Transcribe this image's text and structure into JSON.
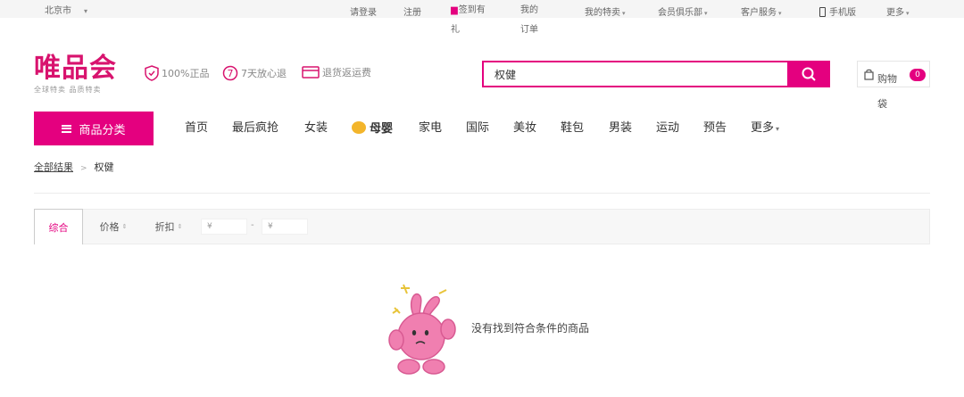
{
  "topbar": {
    "city": "北京市",
    "login": "请登录",
    "register": "注册",
    "signin_gift": "签到有礼",
    "my_orders": "我的订单",
    "my_special": "我的特卖",
    "member_club": "会员俱乐部",
    "customer_service": "客户服务",
    "mobile": "手机版",
    "more": "更多"
  },
  "header": {
    "logo": "唯品会",
    "slogan": "全球特卖 品质特卖",
    "promises": [
      "100%正品",
      "7天放心退",
      "退货返运费"
    ]
  },
  "search": {
    "query": "权健"
  },
  "cart": {
    "label": "购物袋",
    "count": "0"
  },
  "nav": {
    "category_button": "商品分类",
    "items": [
      "首页",
      "最后疯抢",
      "女装",
      "母婴",
      "家电",
      "国际",
      "美妆",
      "鞋包",
      "男装",
      "运动",
      "预告",
      "更多"
    ]
  },
  "breadcrumb": {
    "root": "全部结果",
    "current": "权健"
  },
  "filters": {
    "sorts": [
      "综合",
      "价格",
      "折扣"
    ],
    "price_min_placeholder": "¥",
    "price_max_placeholder": "¥",
    "price_separator": "-"
  },
  "empty_state": {
    "message": "没有找到符合条件的商品"
  },
  "colors": {
    "brand": "#e4007f",
    "logo": "#d8136e",
    "mascot": "#f07fb0"
  }
}
